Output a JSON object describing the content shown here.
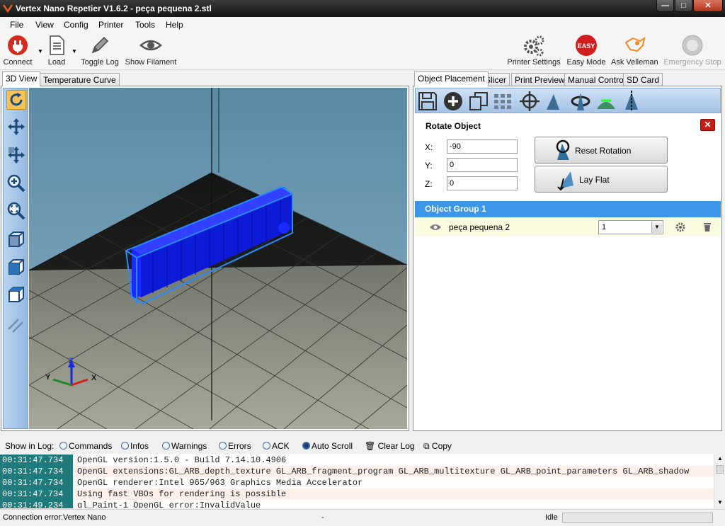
{
  "window": {
    "title": "Vertex Nano Repetier V1.6.2 - peça pequena 2.stl"
  },
  "menu": [
    "File",
    "View",
    "Config",
    "Printer",
    "Tools",
    "Help"
  ],
  "toolbar": {
    "connect": "Connect",
    "load": "Load",
    "toggle_log": "Toggle Log",
    "show_filament": "Show Filament",
    "printer_settings": "Printer Settings",
    "easy_mode": "Easy Mode",
    "easy_badge": "EASY",
    "ask_velleman": "Ask Velleman",
    "emergency_stop": "Emergency Stop"
  },
  "left_tabs": [
    "3D View",
    "Temperature Curve"
  ],
  "right_tabs": [
    "Object Placement",
    "Slicer",
    "Print Preview",
    "Manual Control",
    "SD Card"
  ],
  "rotate": {
    "title": "Rotate Object",
    "x_label": "X:",
    "x_value": "-90",
    "y_label": "Y:",
    "y_value": "0",
    "z_label": "Z:",
    "z_value": "0",
    "reset_label": "Reset Rotation",
    "lay_flat_label": "Lay Flat"
  },
  "object_group": {
    "title": "Object Group 1",
    "items": [
      {
        "name": "peça pequena 2",
        "copies": "1"
      }
    ]
  },
  "axis_labels": {
    "x": "X",
    "y": "Y",
    "z": "Z"
  },
  "log_bar": {
    "show_in_log": "Show in Log:",
    "commands": "Commands",
    "infos": "Infos",
    "warnings": "Warnings",
    "errors": "Errors",
    "ack": "ACK",
    "auto_scroll": "Auto Scroll",
    "clear_log": "Clear Log",
    "copy": "Copy"
  },
  "log": [
    {
      "time": "00:31:47.734",
      "msg": "OpenGL version:1.5.0 - Build 7.14.10.4906"
    },
    {
      "time": "00:31:47.734",
      "msg": "OpenGL extensions:GL_ARB_depth_texture GL_ARB_fragment_program GL_ARB_multitexture GL_ARB_point_parameters GL_ARB_shadow"
    },
    {
      "time": "00:31:47.734",
      "msg": "OpenGL renderer:Intel 965/963 Graphics Media Accelerator"
    },
    {
      "time": "00:31:47.734",
      "msg": "Using fast VBOs for rendering is possible"
    },
    {
      "time": "00:31:49.234",
      "msg": "gl_Paint-1 OpenGL error:InvalidValue"
    }
  ],
  "status": {
    "left": "Connection error:Vertex Nano",
    "mid": "-",
    "right": "Idle"
  },
  "colors": {
    "accent": "#3b96e8",
    "object": "#1b2bff",
    "log_time_bg": "#1f7a7c"
  }
}
